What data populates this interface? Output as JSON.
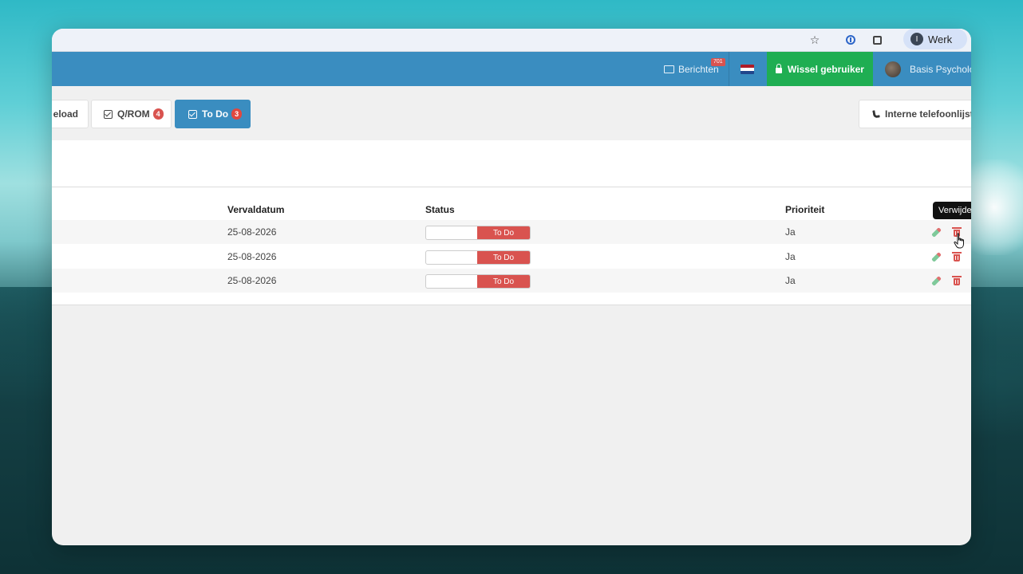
{
  "browser": {
    "profile_initial": "I",
    "profile_label": "Werk"
  },
  "navbar": {
    "messages_label": "Berichten",
    "messages_badge": "701",
    "switch_user_label": "Wissel gebruiker",
    "user_label": "Basis Psycholo",
    "flag_colors": [
      "#ae1c28",
      "#ffffff",
      "#21468b"
    ]
  },
  "tabs": [
    {
      "label": "eload",
      "badge": ""
    },
    {
      "label": "Q/ROM",
      "badge": "4"
    },
    {
      "label": "To Do",
      "badge": "3",
      "active": true
    }
  ],
  "phone_button_label": "Interne telefoonlijst",
  "table": {
    "headers": {
      "due_date": "Vervaldatum",
      "status": "Status",
      "priority": "Prioriteit"
    },
    "rows": [
      {
        "due_date": "25-08-2026",
        "status": "To Do",
        "priority": "Ja"
      },
      {
        "due_date": "25-08-2026",
        "status": "To Do",
        "priority": "Ja"
      },
      {
        "due_date": "25-08-2026",
        "status": "To Do",
        "priority": "Ja"
      }
    ]
  },
  "tooltip": "Verwijde",
  "colors": {
    "navbar": "#3a8dc0",
    "switch_user": "#1fae52",
    "danger": "#d9534f"
  }
}
